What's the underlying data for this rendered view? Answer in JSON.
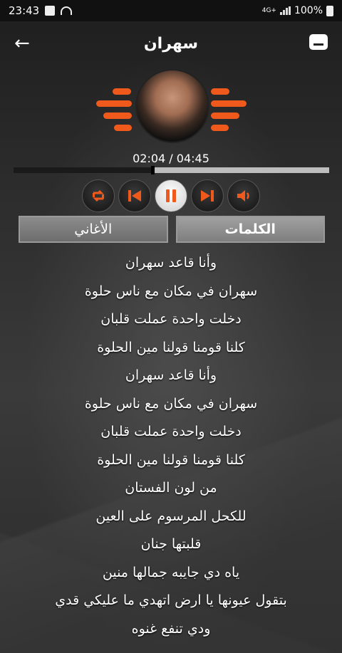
{
  "status_bar": {
    "time": "23:43",
    "network": "4G+",
    "battery": "100%"
  },
  "header": {
    "title": "سهران"
  },
  "player": {
    "current_time": "02:04",
    "total_time": "04:45",
    "time_display": "02:04 / 04:45",
    "progress": 0.44,
    "accent_color": "#ef5a1c"
  },
  "tabs": [
    {
      "label": "الكلمات",
      "active": true
    },
    {
      "label": "الأغاني",
      "active": false
    }
  ],
  "lyrics": [
    "وأنا قاعد سهران",
    "سهران في مكان مع ناس حلوة",
    "دخلت واحدة عملت قلبان",
    "كلنا قومنا قولنا مين الحلوة",
    "وأنا قاعد سهران",
    "سهران في مكان مع ناس حلوة",
    "دخلت واحدة عملت قلبان",
    "كلنا قومنا قولنا مين الحلوة",
    "من لون الفستان",
    "للكحل المرسوم على العين",
    "قلبتها جنان",
    "ياه دي جايبه جمالها منين",
    "بتقول عيونها يا ارض اتهدي ما عليكي قدي",
    "ودي تنفع غنوه"
  ],
  "icons": {
    "back": "arrow-left-icon",
    "menu": "menu-icon",
    "repeat": "repeat-icon",
    "previous": "previous-icon",
    "pause": "pause-icon",
    "next": "next-icon",
    "volume": "volume-icon"
  }
}
